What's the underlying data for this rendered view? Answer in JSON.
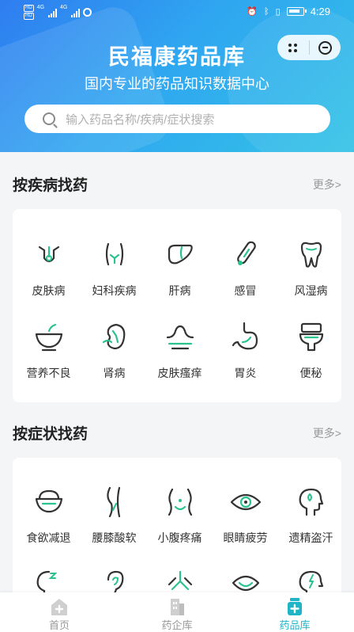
{
  "status_bar": {
    "hd1": "HD",
    "hd2": "HD",
    "net1": "4G",
    "net2": "4G",
    "time": "4:29"
  },
  "header": {
    "title": "民福康药品库",
    "subtitle": "国内专业的药品知识数据中心"
  },
  "search": {
    "placeholder": "输入药品名称/疾病/症状搜索"
  },
  "disease_section": {
    "title": "按疾病找药",
    "more": "更多>",
    "items": [
      {
        "label": "皮肤病",
        "icon": "skin-icon"
      },
      {
        "label": "妇科疾病",
        "icon": "gynecology-icon"
      },
      {
        "label": "肝病",
        "icon": "liver-icon"
      },
      {
        "label": "感冒",
        "icon": "thermometer-icon"
      },
      {
        "label": "风湿病",
        "icon": "tooth-icon"
      },
      {
        "label": "营养不良",
        "icon": "bowl-icon"
      },
      {
        "label": "肾病",
        "icon": "kidney-icon"
      },
      {
        "label": "皮肤瘙痒",
        "icon": "itch-icon"
      },
      {
        "label": "胃炎",
        "icon": "stomach-icon"
      },
      {
        "label": "便秘",
        "icon": "toilet-icon"
      }
    ]
  },
  "symptom_section": {
    "title": "按症状找药",
    "more": "更多>",
    "items": [
      {
        "label": "食欲减退",
        "icon": "rice-bowl-icon"
      },
      {
        "label": "腰膝酸软",
        "icon": "waist-icon"
      },
      {
        "label": "小腹疼痛",
        "icon": "abdomen-icon"
      },
      {
        "label": "眼睛疲劳",
        "icon": "eye-icon"
      },
      {
        "label": "遗精盗汗",
        "icon": "head-sweat-icon"
      }
    ]
  },
  "tabbar": {
    "tabs": [
      {
        "label": "首页",
        "icon": "home-icon"
      },
      {
        "label": "药企库",
        "icon": "building-icon"
      },
      {
        "label": "药品库",
        "icon": "medicine-bottle-icon"
      }
    ],
    "active_color": "#1fb5c7"
  },
  "colors": {
    "header_gradient_start": "#2f7df0",
    "header_gradient_end": "#33c3e6",
    "icon_dark": "#333333",
    "icon_accent": "#2bc28d"
  }
}
